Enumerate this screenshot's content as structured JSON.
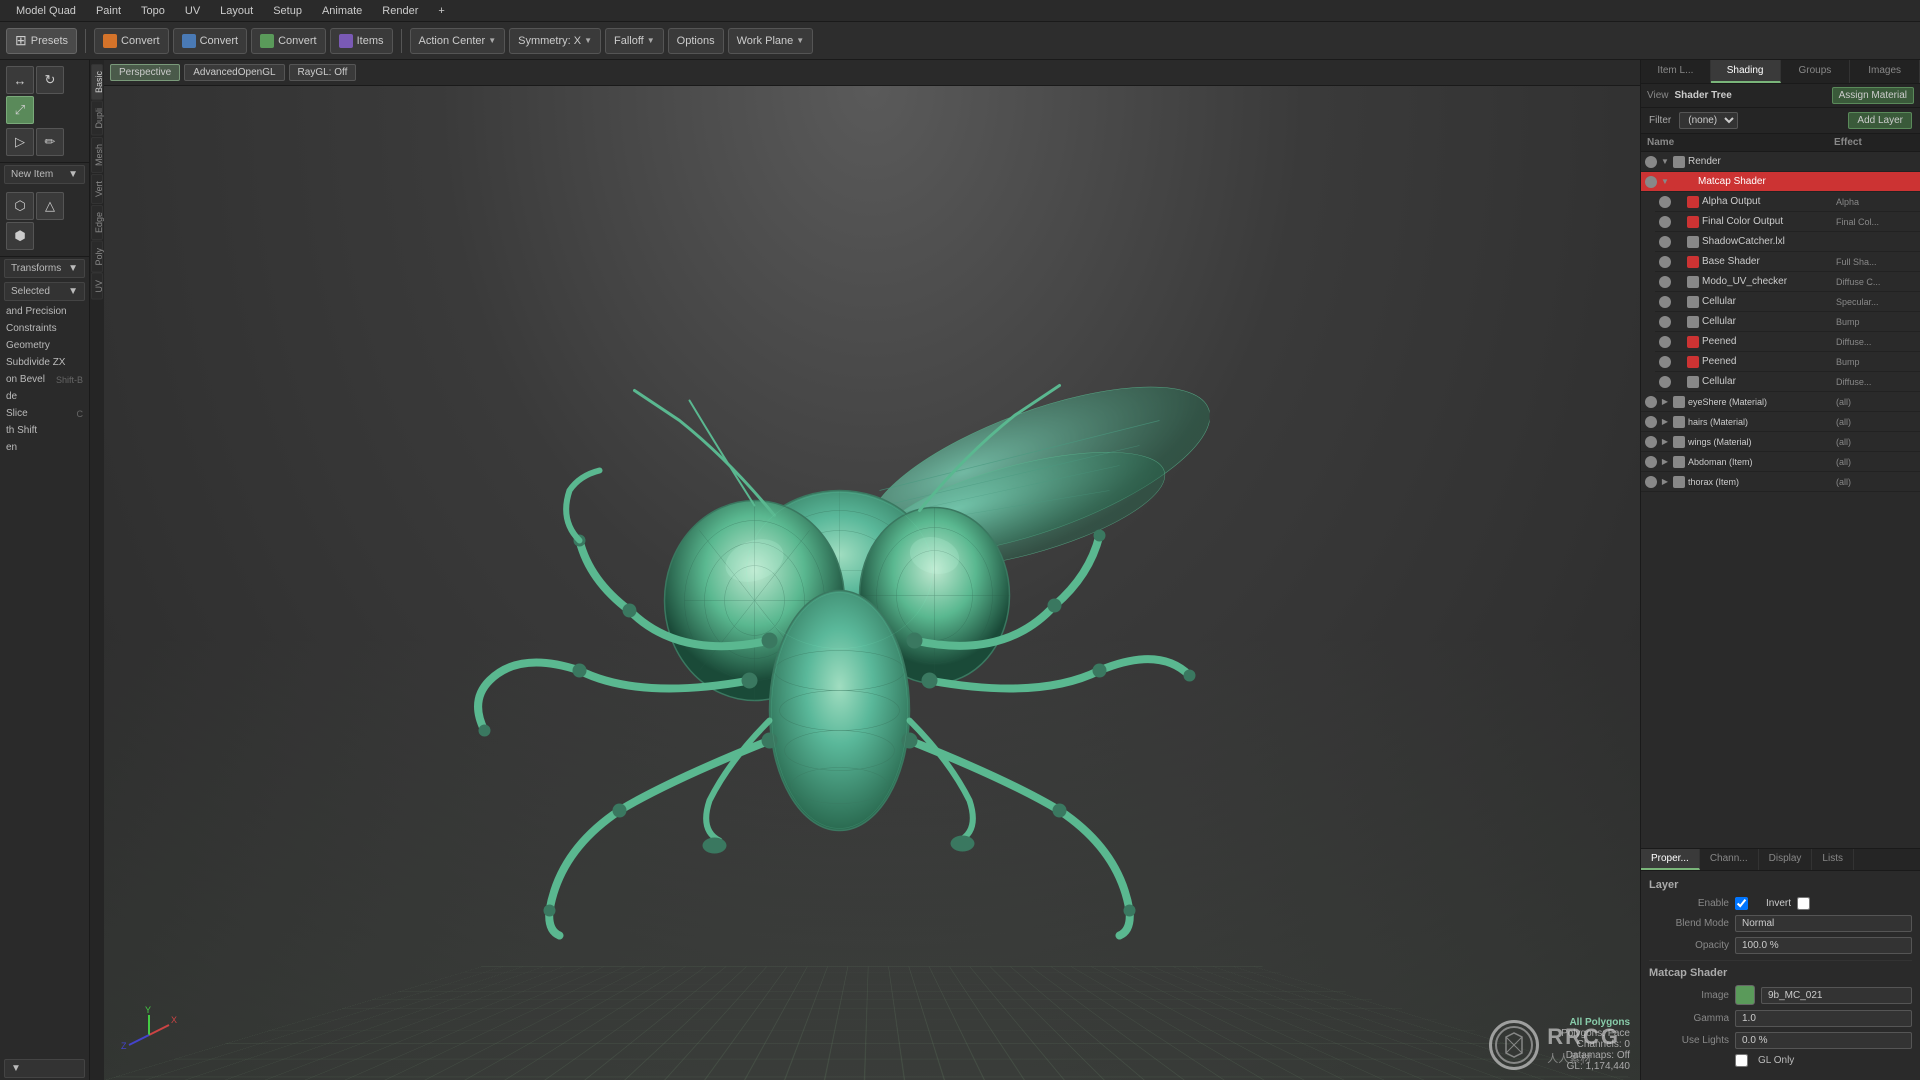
{
  "menu": {
    "items": [
      "Model Quad",
      "Paint",
      "Topo",
      "UV",
      "Layout",
      "Setup",
      "Animate",
      "Render",
      "+"
    ]
  },
  "toolbar": {
    "presets_label": "Presets",
    "convert_btns": [
      "Convert",
      "Convert",
      "Convert"
    ],
    "items_label": "Items",
    "action_center_label": "Action Center",
    "symmetry_label": "Symmetry: X",
    "falloff_label": "Falloff",
    "options_label": "Options",
    "work_plane_label": "Work Plane"
  },
  "viewport": {
    "view_btn": "Perspective",
    "render_btn": "AdvancedOpenGL",
    "ray_btn": "RayGL: Off",
    "info": {
      "mode": "All Polygons",
      "polygons": "Polygons: Face",
      "channels": "Channels: 0",
      "datamaps": "Datamaps: Off",
      "gl": "GL: 1,174,440"
    }
  },
  "left_sidebar": {
    "sections": {
      "new_item_label": "New Item",
      "transforms_label": "Transforms",
      "selected_label": "Selected",
      "and_precision_label": "and Precision",
      "constraints_label": "Constraints",
      "geometry_label": "Geometry",
      "subdivide_label": "Subdivide ZX",
      "bevel_label": "on Bevel",
      "bevel_shortcut": "Shift-B",
      "slide_label": "de",
      "slice_label": "Slice",
      "slice_shortcut": "C",
      "shift_label": "th Shift",
      "open_label": "en"
    }
  },
  "right_panel": {
    "top_tabs": [
      "Item L...",
      "Shading",
      "Groups",
      "Images"
    ],
    "active_top_tab": "Shading",
    "view_label": "View",
    "shader_tree_label": "Shader Tree",
    "assign_material_label": "Assign Material",
    "filter_label": "Filter",
    "filter_value": "(none)",
    "add_layer_label": "Add Layer",
    "columns": {
      "name": "Name",
      "effect": "Effect"
    },
    "shader_items": [
      {
        "name": "Render",
        "effect": "",
        "color": "#888888",
        "indent": 0,
        "type": "folder"
      },
      {
        "name": "Matcap Shader",
        "effect": "",
        "color": "#cc3333",
        "indent": 1,
        "selected": true
      },
      {
        "name": "Alpha Output",
        "effect": "Alpha",
        "color": "#cc3333",
        "indent": 2
      },
      {
        "name": "Final Color Output",
        "effect": "Final Col...",
        "color": "#cc3333",
        "indent": 2
      },
      {
        "name": "ShadowCatcher.lxl",
        "effect": "",
        "color": "#888888",
        "indent": 2
      },
      {
        "name": "Base Shader",
        "effect": "Full Sha...",
        "color": "#cc3333",
        "indent": 2
      },
      {
        "name": "Modo_UV_checker",
        "effect": "Diffuse C...",
        "color": "#888888",
        "indent": 2
      },
      {
        "name": "Cellular",
        "effect": "Specular...",
        "color": "#888888",
        "indent": 2
      },
      {
        "name": "Cellular",
        "effect": "Bump",
        "color": "#888888",
        "indent": 2
      },
      {
        "name": "Peened",
        "effect": "Diffuse...",
        "color": "#cc3333",
        "indent": 2
      },
      {
        "name": "Peened",
        "effect": "Bump",
        "color": "#cc3333",
        "indent": 2
      },
      {
        "name": "Cellular",
        "effect": "Diffuse...",
        "color": "#888888",
        "indent": 2
      },
      {
        "name": "eyeShere (Material)",
        "effect": "(all)",
        "color": "#888888",
        "indent": 1
      },
      {
        "name": "hairs (Material)",
        "effect": "(all)",
        "color": "#888888",
        "indent": 1
      },
      {
        "name": "wings (Material)",
        "effect": "(all)",
        "color": "#888888",
        "indent": 1
      },
      {
        "name": "Abdoman (Item)",
        "effect": "(all)",
        "color": "#888888",
        "indent": 1
      },
      {
        "name": "thorax (Item)",
        "effect": "(all)",
        "color": "#888888",
        "indent": 1
      }
    ],
    "bottom_tabs": [
      "Proper...",
      "Chann...",
      "Display",
      "Lists"
    ],
    "active_bottom_tab": "Proper...",
    "properties": {
      "layer_label": "Layer",
      "enable_label": "Enable",
      "enable_checked": true,
      "invert_label": "Invert",
      "blend_mode_label": "Blend Mode",
      "blend_mode_value": "Normal",
      "opacity_label": "Opacity",
      "opacity_value": "100.0 %",
      "matcap_shader_label": "Matcap Shader",
      "image_label": "Image",
      "image_name": "9b_MC_021",
      "image_color": "#5a9a5a",
      "gamma_label": "Gamma",
      "gamma_value": "1.0",
      "use_lights_label": "Use Lights",
      "use_lights_value": "0.0 %",
      "gl_only_label": "GL Only"
    }
  },
  "axis": {
    "x_label": "X",
    "y_label": "Y",
    "z_label": "Z"
  }
}
